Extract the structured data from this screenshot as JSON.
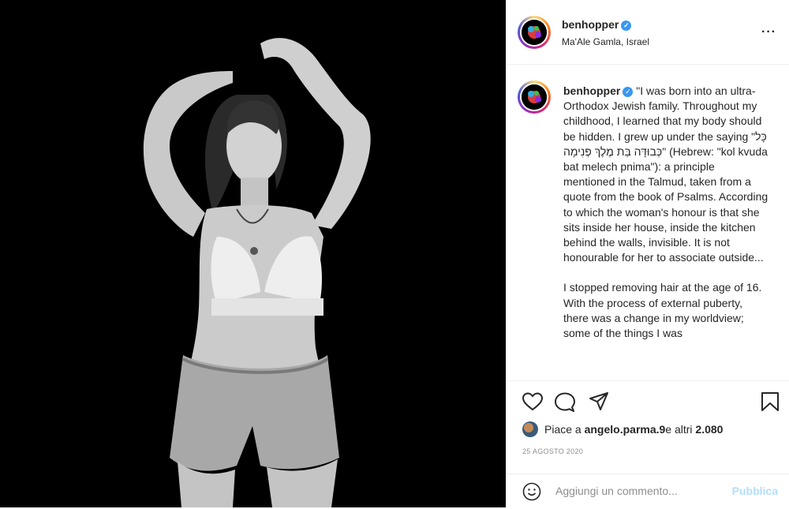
{
  "post": {
    "username": "benhopper",
    "location": "Ma'Ale Gamla, Israel",
    "more_icon": "more-horizontal-icon",
    "verified_icon": "verified-badge-icon"
  },
  "caption": {
    "username": "benhopper",
    "paragraph_1": "\"I was born into an ultra-Orthodox Jewish family. Throughout my childhood, I learned that my body should be hidden. I grew up under the saying \"כָּל כְּבוּדָּה בַּת מֶלֶךְ פְּנִימָה\" (Hebrew: \"kol kvuda bat melech pnima\"): a principle mentioned in the Talmud, taken from a quote from the book of Psalms. According to which the woman's honour is that she sits inside her house, inside the kitchen behind the walls, invisible. It is not honourable for her to associate outside...",
    "paragraph_2": "I stopped removing hair at the age of 16. With the process of external puberty, there was a change in my worldview; some of the things I was"
  },
  "actions": {
    "like_icon": "heart-icon",
    "comment_icon": "comment-icon",
    "share_icon": "paper-plane-icon",
    "save_icon": "bookmark-icon"
  },
  "likes": {
    "prefix": "Piace a ",
    "user": "angelo.parma.9",
    "suffix": " e altri ",
    "count": "2.080"
  },
  "date": "25 AGOSTO 2020",
  "comment": {
    "emoji_icon": "smiley-icon",
    "placeholder": "Aggiungi un commento...",
    "publish_label": "Pubblica"
  }
}
